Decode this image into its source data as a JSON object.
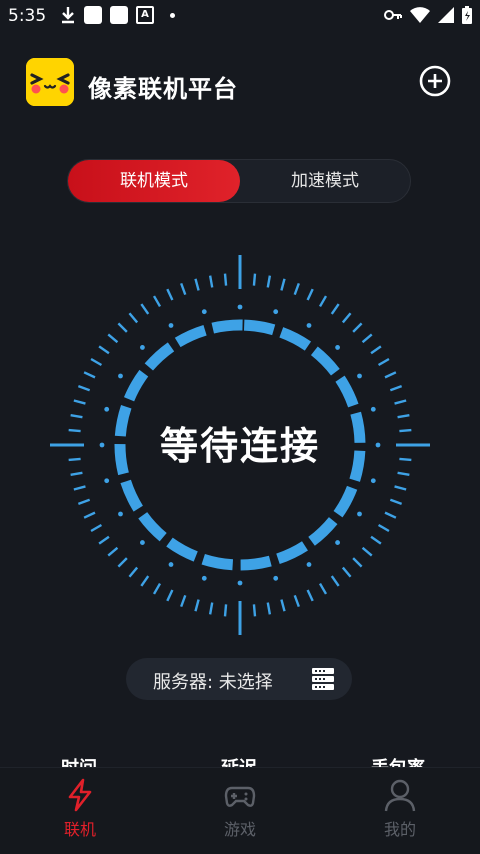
{
  "status_bar": {
    "time": "5:35",
    "a_label": "A"
  },
  "header": {
    "title": "像素联机平台"
  },
  "mode_tabs": [
    {
      "label": "联机模式",
      "active": true
    },
    {
      "label": "加速模式",
      "active": false
    }
  ],
  "dial": {
    "status": "等待连接",
    "accent_color": "#3ea2e6"
  },
  "server": {
    "label": "服务器: 未选择"
  },
  "stats": [
    {
      "label": "时间"
    },
    {
      "label": "延迟"
    },
    {
      "label": "丢包率"
    }
  ],
  "nav": [
    {
      "label": "联机",
      "icon": "lightning-icon",
      "active": true,
      "color": "#e0202a"
    },
    {
      "label": "游戏",
      "icon": "gamepad-icon",
      "active": false,
      "color": "#5c6068"
    },
    {
      "label": "我的",
      "icon": "user-icon",
      "active": false,
      "color": "#5c6068"
    }
  ]
}
